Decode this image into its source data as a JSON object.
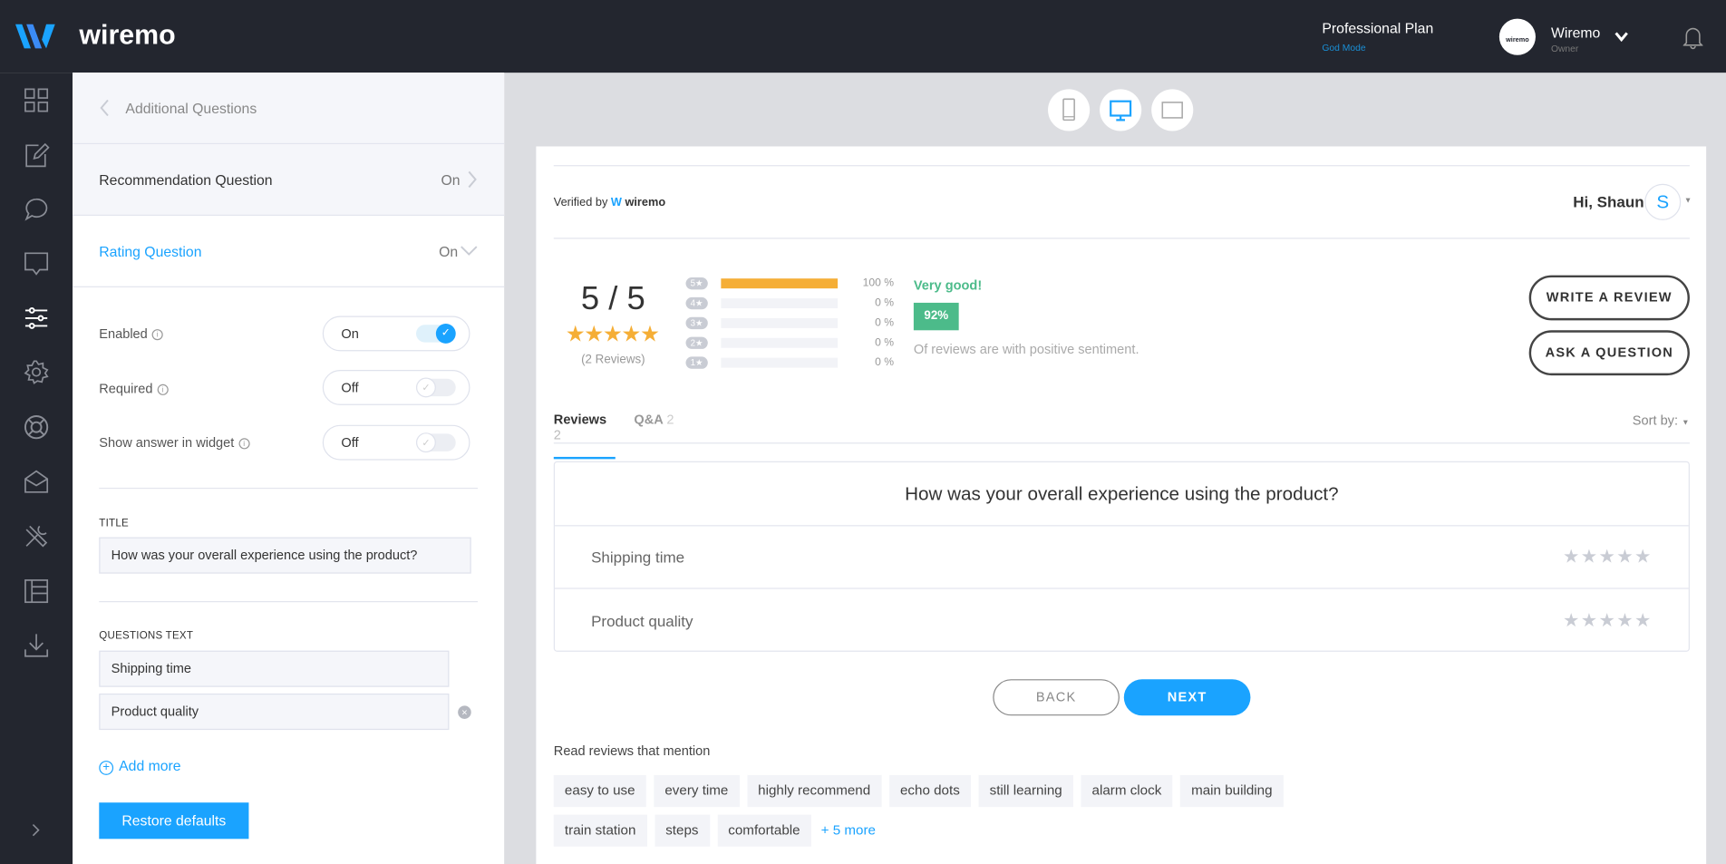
{
  "app": {
    "brand": "wiremo",
    "plan": "Professional Plan",
    "plan_mode": "God Mode",
    "account_name": "Wiremo",
    "account_role": "Owner",
    "avatar_text": "wiremo"
  },
  "colors": {
    "accent": "#1aa3ff",
    "topbar": "#23262f",
    "star": "#f5ae36",
    "positive": "#4cbb8a"
  },
  "rail": {
    "icons": [
      "dashboard-icon",
      "edit-icon",
      "chat-icon",
      "comment-icon",
      "sliders-icon",
      "gear-icon",
      "lifebuoy-icon",
      "mail-icon",
      "tools-icon",
      "table-icon",
      "download-icon"
    ],
    "active": "sliders-icon"
  },
  "panel": {
    "back_label": "Additional Questions",
    "recommendation": {
      "label": "Recommendation Question",
      "status": "On"
    },
    "rating": {
      "label": "Rating Question",
      "status": "On"
    },
    "enabled": {
      "label": "Enabled",
      "value": "On",
      "checked": true
    },
    "required": {
      "label": "Required",
      "value": "Off",
      "checked": false
    },
    "show_answer": {
      "label": "Show answer in widget",
      "value": "Off",
      "checked": false
    },
    "title_caption": "TITLE",
    "title_value": "How was your overall experience using the product?",
    "questions_caption": "QUESTIONS TEXT",
    "questions": [
      "Shipping time",
      "Product quality"
    ],
    "add_more": "Add more",
    "restore": "Restore defaults"
  },
  "preview": {
    "devices": [
      "mobile-icon",
      "desktop-icon",
      "tablet-icon"
    ],
    "active_device": "desktop-icon",
    "verified_by": "Verified by",
    "verified_brand": "wiremo",
    "greeting": "Hi, Shaun",
    "user_initial": "S",
    "score": "5 / 5",
    "stars": 5,
    "reviews_count": "(2 Reviews)",
    "breakdown": [
      {
        "star": "5",
        "pct": 100,
        "label": "100 %"
      },
      {
        "star": "4",
        "pct": 0,
        "label": "0 %"
      },
      {
        "star": "3",
        "pct": 0,
        "label": "0 %"
      },
      {
        "star": "2",
        "pct": 0,
        "label": "0 %"
      },
      {
        "star": "1",
        "pct": 0,
        "label": "0 %"
      }
    ],
    "sentiment_title": "Very good!",
    "sentiment_pct": "92%",
    "sentiment_text": "Of reviews are with positive sentiment.",
    "write_review": "WRITE A REVIEW",
    "ask_question": "ASK A QUESTION",
    "tabs": [
      {
        "label": "Reviews",
        "count": "2"
      },
      {
        "label": "Q&A",
        "count": "2"
      }
    ],
    "sort_by": "Sort by:",
    "question_title": "How was your overall experience using the product?",
    "rating_rows": [
      "Shipping time",
      "Product quality"
    ],
    "back": "BACK",
    "next": "NEXT",
    "mentions_title": "Read reviews that mention",
    "tags": [
      "easy to use",
      "every time",
      "highly recommend",
      "echo dots",
      "still learning",
      "alarm clock",
      "main building",
      "train station",
      "steps",
      "comfortable"
    ],
    "more": "+ 5 more"
  }
}
